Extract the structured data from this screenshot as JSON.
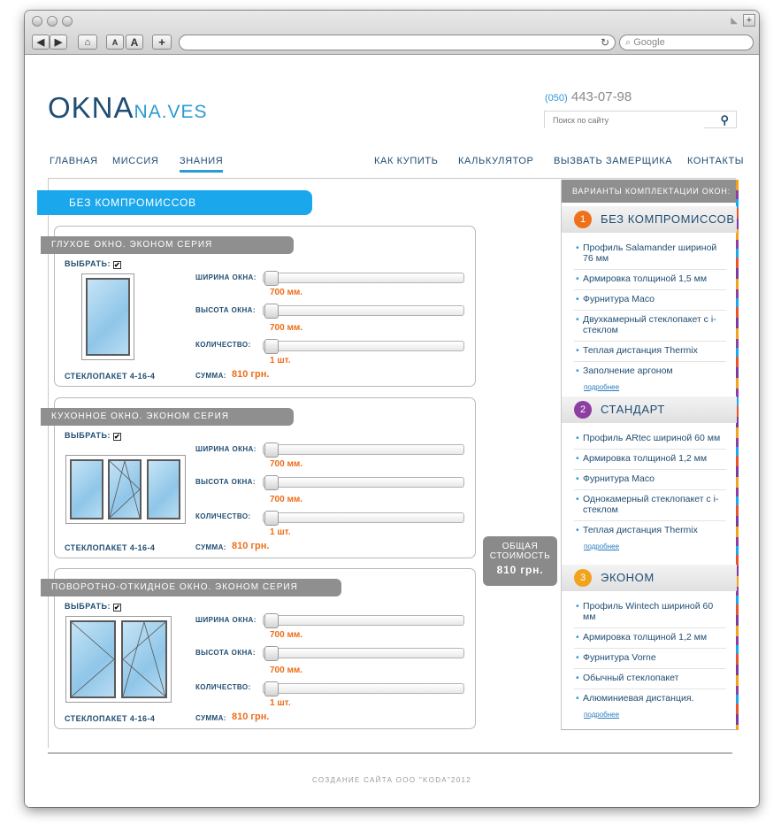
{
  "browser": {
    "search_placeholder": "Google",
    "buttons": [
      "A",
      "A",
      "+"
    ]
  },
  "site": {
    "logo_main": "OKNA",
    "logo_sub": "NA.VES",
    "phone_code": "(050)",
    "phone_number": "443-07-98",
    "search_placeholder": "Поиск по сайту"
  },
  "nav": {
    "home": "ГЛАВНАЯ",
    "mission": "МИССИЯ",
    "knowledge": "ЗНАНИЯ",
    "how_to_buy": "КАК КУПИТЬ",
    "calculator": "КАЛЬКУЛЯТОР",
    "measurer": "ВЫЗВАТЬ ЗАМЕРЩИКА",
    "contacts": "КОНТАКТЫ"
  },
  "main_tab": "БЕЗ КОМПРОМИССОВ",
  "cards": [
    {
      "title": "ГЛУХОЕ ОКНО. ЭКОНОМ СЕРИЯ",
      "select_label": "ВЫБРАТЬ:",
      "check": "✔",
      "width_label": "ШИРИНА ОКНА:",
      "width_value": "700 мм.",
      "height_label": "ВЫСОТА ОКНА:",
      "height_value": "700 мм.",
      "qty_label": "КОЛИЧЕСТВО:",
      "qty_value": "1 шт.",
      "glass": "СТЕКЛОПАКЕТ 4-16-4",
      "sum_label": "СУММА:",
      "sum_value": "810 грн."
    },
    {
      "title": "КУХОННОЕ ОКНО. ЭКОНОМ СЕРИЯ",
      "select_label": "ВЫБРАТЬ:",
      "check": "✔",
      "width_label": "ШИРИНА ОКНА:",
      "width_value": "700 мм.",
      "height_label": "ВЫСОТА ОКНА:",
      "height_value": "700 мм.",
      "qty_label": "КОЛИЧЕСТВО:",
      "qty_value": "1 шт.",
      "glass": "СТЕКЛОПАКЕТ 4-16-4",
      "sum_label": "СУММА:",
      "sum_value": "810 грн."
    },
    {
      "title": "ПОВОРОТНО-ОТКИДНОЕ ОКНО. ЭКОНОМ СЕРИЯ",
      "select_label": "ВЫБРАТЬ:",
      "check": "✔",
      "width_label": "ШИРИНА ОКНА:",
      "width_value": "700 мм.",
      "height_label": "ВЫСОТА ОКНА:",
      "height_value": "700 мм.",
      "qty_label": "КОЛИЧЕСТВО:",
      "qty_value": "1 шт.",
      "glass": "СТЕКЛОПАКЕТ 4-16-4",
      "sum_label": "СУММА:",
      "sum_value": "810 грн."
    }
  ],
  "total": {
    "label_line1": "ОБЩАЯ",
    "label_line2": "СТОИМОСТЬ",
    "value": "810 грн."
  },
  "sidebar": {
    "title": "ВАРИАНТЫ КОМПЛЕКТАЦИИ ОКОН:",
    "more": "подробнее",
    "packages": [
      {
        "num": "1",
        "color": "#f0701a",
        "name": "БЕЗ КОМПРОМИССОВ",
        "items": [
          "Профиль Salamander шириной 76 мм",
          "Армировка толщиной 1,5 мм",
          "Фурнитура Maco",
          "Двухкамерный стеклопакет с i-стеклом",
          "Теплая дистанция Thermix",
          "Заполнение аргоном"
        ]
      },
      {
        "num": "2",
        "color": "#8d3ea2",
        "name": "СТАНДАРТ",
        "items": [
          "Профиль ARtec шириной 60 мм",
          "Армировка толщиной 1,2 мм",
          "Фурнитура Maco",
          "Однокамерный стеклопакет с i-стеклом",
          "Теплая дистанция Thermix"
        ]
      },
      {
        "num": "3",
        "color": "#f0a31b",
        "name": "ЭКОНОМ",
        "items": [
          "Профиль Wintech шириной 60 мм",
          "Армировка толщиной 1,2 мм",
          "Фурнитура Vorne",
          "Обычный стеклопакет",
          "Алюминиевая дистанция."
        ]
      }
    ]
  },
  "footer": "СОЗДАНИЕ САЙТА ООО \"KODA\"2012"
}
